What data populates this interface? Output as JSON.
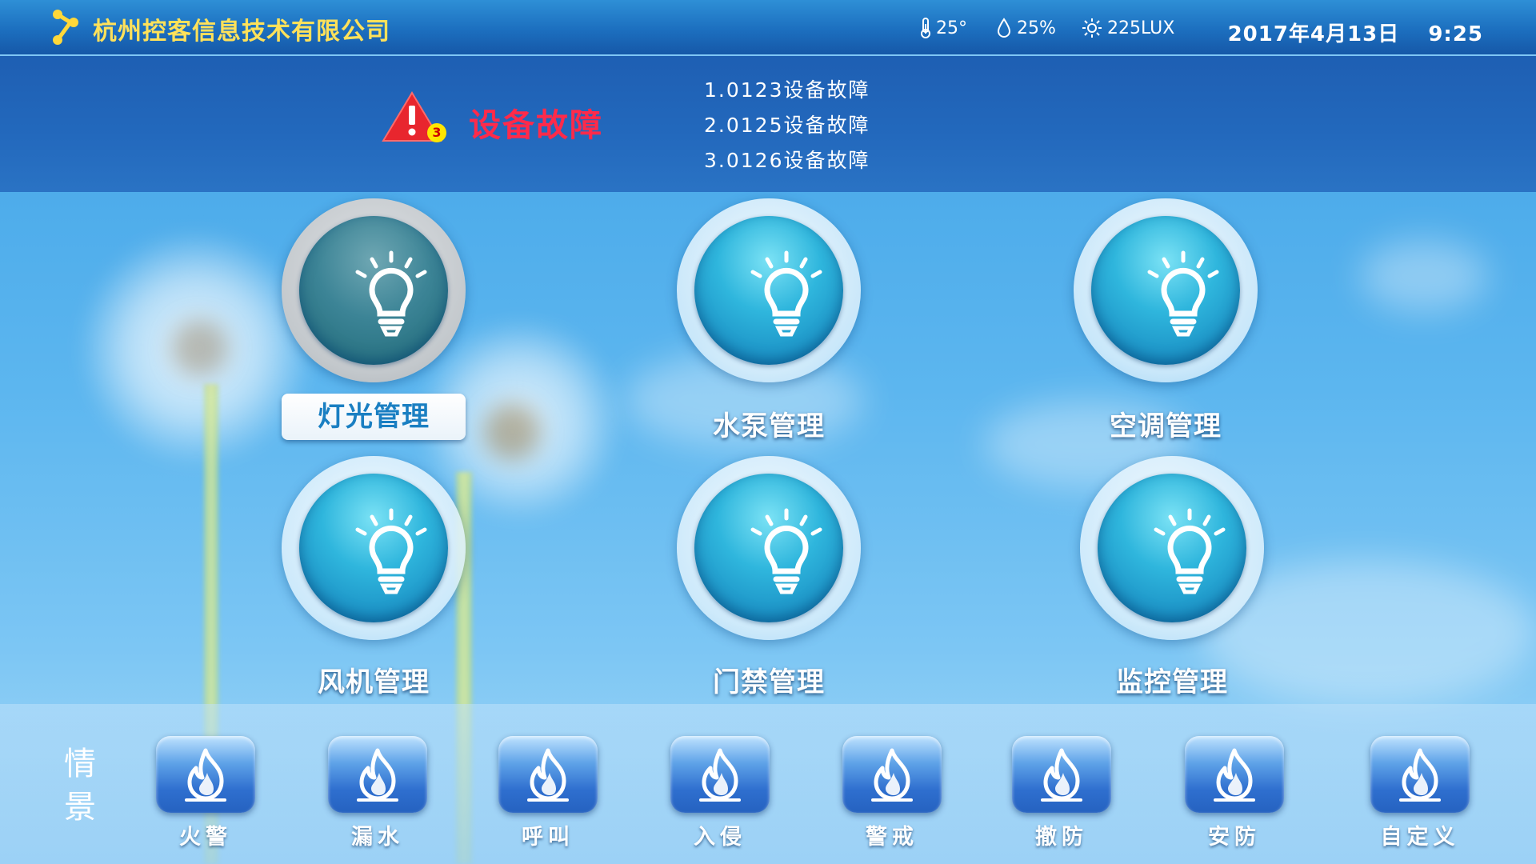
{
  "header": {
    "company": "杭州控客信息技术有限公司",
    "temperature": "25°",
    "humidity": "25%",
    "illuminance": "225LUX",
    "date": "2017年4月13日",
    "time": "9:25"
  },
  "alert": {
    "count": "3",
    "title": "设备故障",
    "items": [
      "1.0123设备故障",
      "2.0125设备故障",
      "3.0126设备故障"
    ]
  },
  "menu": [
    {
      "label": "灯光管理",
      "icon": "lightbulb-icon",
      "selected": true
    },
    {
      "label": "水泵管理",
      "icon": "lightbulb-icon",
      "selected": false
    },
    {
      "label": "空调管理",
      "icon": "lightbulb-icon",
      "selected": false
    },
    {
      "label": "风机管理",
      "icon": "lightbulb-icon",
      "selected": false
    },
    {
      "label": "门禁管理",
      "icon": "lightbulb-icon",
      "selected": false
    },
    {
      "label": "监控管理",
      "icon": "lightbulb-icon",
      "selected": false
    }
  ],
  "scenes": {
    "title": "情景",
    "items": [
      {
        "label": "火警",
        "icon": "flame-icon"
      },
      {
        "label": "漏水",
        "icon": "flame-icon"
      },
      {
        "label": "呼叫",
        "icon": "flame-icon"
      },
      {
        "label": "入侵",
        "icon": "flame-icon"
      },
      {
        "label": "警戒",
        "icon": "flame-icon"
      },
      {
        "label": "撤防",
        "icon": "flame-icon"
      },
      {
        "label": "安防",
        "icon": "flame-icon"
      },
      {
        "label": "自定义",
        "icon": "flame-icon"
      }
    ]
  },
  "colors": {
    "accent": "#ffe15a",
    "alert": "#ff2a4a"
  }
}
